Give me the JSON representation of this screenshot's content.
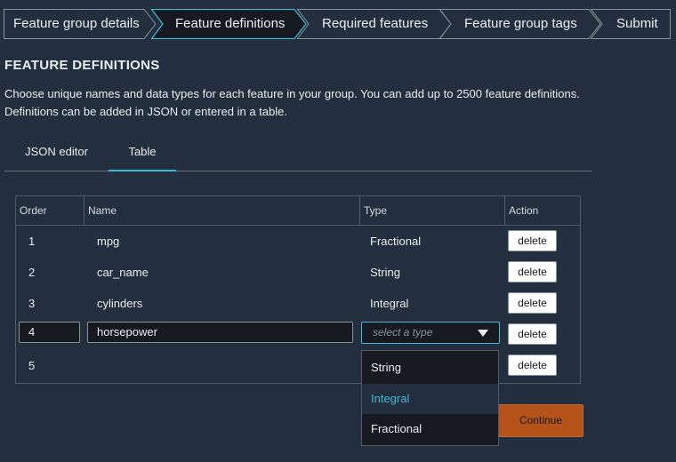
{
  "wizard": {
    "steps": [
      {
        "label": "Feature group details"
      },
      {
        "label": "Feature definitions"
      },
      {
        "label": "Required features"
      },
      {
        "label": "Feature group tags"
      },
      {
        "label": "Submit"
      }
    ],
    "active_step_index": 1
  },
  "section": {
    "title": "FEATURE DEFINITIONS",
    "description": "Choose unique names and data types for each feature in your group. You can add up to 2500 feature definitions. Definitions can be added in JSON or entered in a table."
  },
  "tabs": [
    {
      "label": "JSON editor"
    },
    {
      "label": "Table"
    }
  ],
  "active_tab": "Table",
  "table": {
    "columns": [
      "Order",
      "Name",
      "Type",
      "Action"
    ],
    "rows": [
      {
        "order": "1",
        "name": "mpg",
        "type": "Fractional",
        "action": "delete"
      },
      {
        "order": "2",
        "name": "car_name",
        "type": "String",
        "action": "delete"
      },
      {
        "order": "3",
        "name": "cylinders",
        "type": "Integral",
        "action": "delete"
      },
      {
        "order": "4",
        "name": "horsepower",
        "type": "",
        "action": "delete"
      },
      {
        "order": "5",
        "name": "",
        "type": "",
        "action": "delete"
      }
    ],
    "type_select": {
      "placeholder": "select a type",
      "options": [
        "String",
        "Integral",
        "Fractional"
      ],
      "highlighted": "Integral"
    }
  },
  "footer": {
    "continue_label": "Continue"
  },
  "colors": {
    "background": "#232f3e",
    "accent": "#44b9d6",
    "primary_button": "#b5531b",
    "dropdown_bg": "#16191f"
  }
}
